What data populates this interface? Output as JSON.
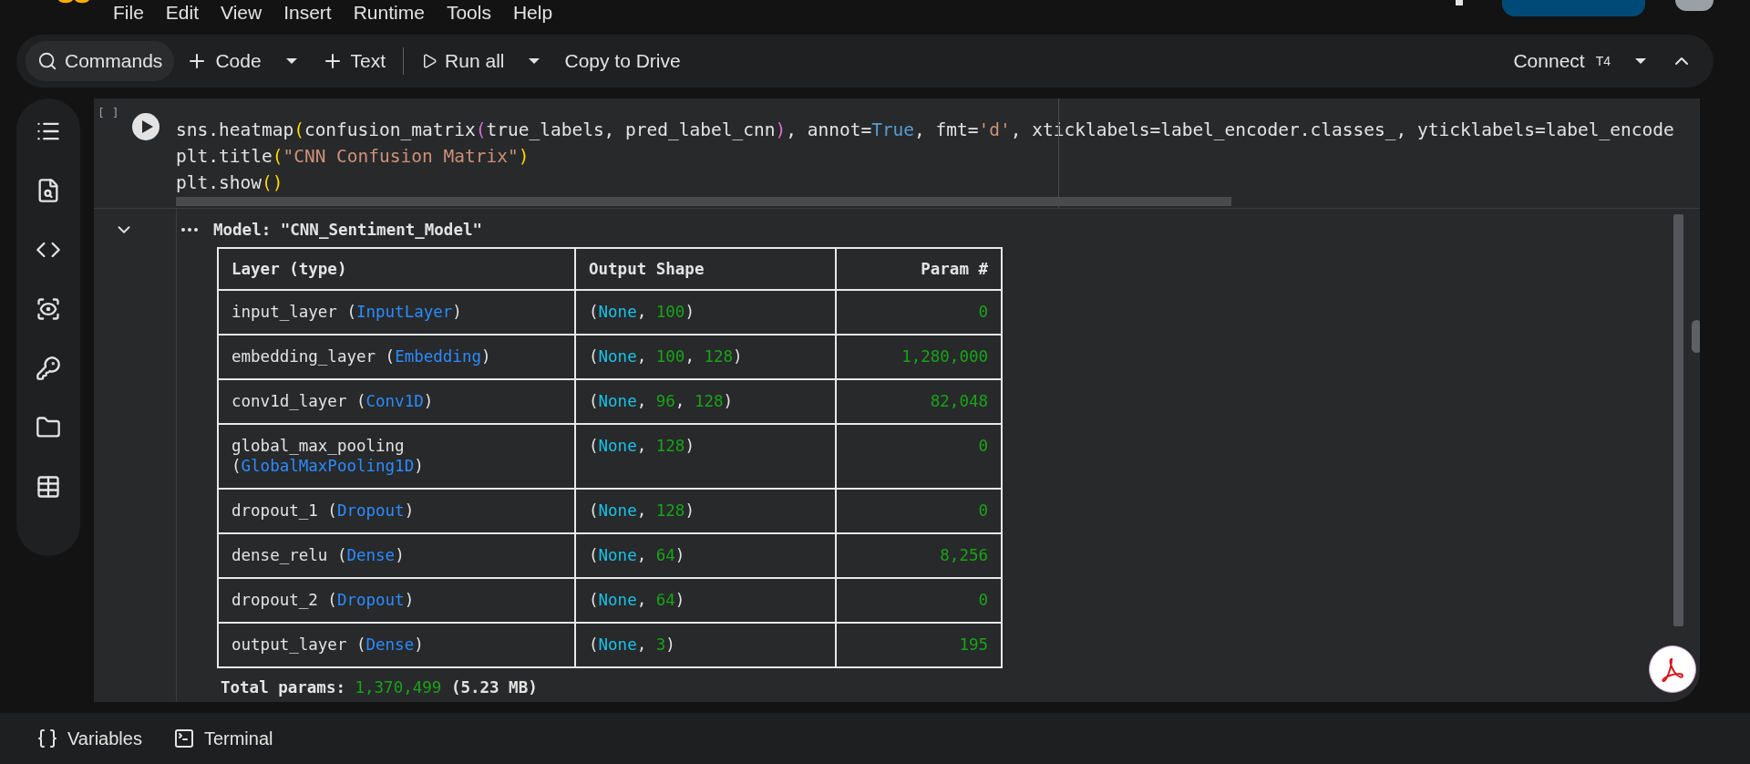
{
  "menu": [
    "File",
    "Edit",
    "View",
    "Insert",
    "Runtime",
    "Tools",
    "Help"
  ],
  "toolbar": [
    {
      "kind": "search",
      "label": "Commands"
    },
    {
      "kind": "add",
      "label": "Code"
    },
    {
      "kind": "caret"
    },
    {
      "kind": "add",
      "label": "Text"
    },
    {
      "kind": "separator"
    },
    {
      "kind": "run",
      "label": "Run all"
    },
    {
      "kind": "caret"
    },
    {
      "kind": "plain",
      "label": "Copy to Drive"
    }
  ],
  "connect": {
    "label": "Connect",
    "runtime": "T4"
  },
  "sidebar": [
    {
      "kind": "toc"
    },
    {
      "kind": "find"
    },
    {
      "kind": "code"
    },
    {
      "kind": "eye"
    },
    {
      "kind": "key"
    },
    {
      "kind": "folder"
    },
    {
      "kind": "table"
    }
  ],
  "cell": {
    "exec_count": "[ ]",
    "code": [
      [
        {
          "kind": "plain",
          "text": "sns.heatmap"
        },
        {
          "kind": "bracket",
          "text": "("
        },
        {
          "kind": "plain",
          "text": "confusion_matrix"
        },
        {
          "kind": "bracket2",
          "text": "("
        },
        {
          "kind": "plain",
          "text": "true_labels, pred_label_cnn"
        },
        {
          "kind": "bracket2",
          "text": ")"
        },
        {
          "kind": "plain",
          "text": ", annot="
        },
        {
          "kind": "keyword",
          "text": "True"
        },
        {
          "kind": "plain",
          "text": ", fmt="
        },
        {
          "kind": "string",
          "text": "'d'"
        },
        {
          "kind": "plain",
          "text": ", xticklabels=label_encoder.classes_, yticklabels=label_encode"
        }
      ],
      [
        {
          "kind": "plain",
          "text": "plt.title"
        },
        {
          "kind": "bracket",
          "text": "("
        },
        {
          "kind": "string",
          "text": "\"CNN Confusion Matrix\""
        },
        {
          "kind": "bracket",
          "text": ")"
        }
      ],
      [
        {
          "kind": "plain",
          "text": "plt.show"
        },
        {
          "kind": "bracket",
          "text": "()"
        }
      ]
    ],
    "output": {
      "title": "Model: \"CNN_Sentiment_Model\"",
      "columns": [
        "Layer (type)",
        "Output Shape",
        "Param #"
      ],
      "rows": [
        [
          [
            {
              "kind": "plain",
              "text": "input_layer ("
            },
            {
              "kind": "type",
              "text": "InputLayer"
            },
            {
              "kind": "plain",
              "text": ")"
            }
          ],
          [
            {
              "kind": "plain",
              "text": "("
            },
            {
              "kind": "none",
              "text": "None"
            },
            {
              "kind": "plain",
              "text": ", "
            },
            {
              "kind": "num",
              "text": "100"
            },
            {
              "kind": "plain",
              "text": ")"
            }
          ],
          [
            {
              "kind": "num",
              "text": "0"
            }
          ]
        ],
        [
          [
            {
              "kind": "plain",
              "text": "embedding_layer ("
            },
            {
              "kind": "type",
              "text": "Embedding"
            },
            {
              "kind": "plain",
              "text": ")"
            }
          ],
          [
            {
              "kind": "plain",
              "text": "("
            },
            {
              "kind": "none",
              "text": "None"
            },
            {
              "kind": "plain",
              "text": ", "
            },
            {
              "kind": "num",
              "text": "100"
            },
            {
              "kind": "plain",
              "text": ", "
            },
            {
              "kind": "num",
              "text": "128"
            },
            {
              "kind": "plain",
              "text": ")"
            }
          ],
          [
            {
              "kind": "num",
              "text": "1,280,000"
            }
          ]
        ],
        [
          [
            {
              "kind": "plain",
              "text": "conv1d_layer ("
            },
            {
              "kind": "type",
              "text": "Conv1D"
            },
            {
              "kind": "plain",
              "text": ")"
            }
          ],
          [
            {
              "kind": "plain",
              "text": "("
            },
            {
              "kind": "none",
              "text": "None"
            },
            {
              "kind": "plain",
              "text": ", "
            },
            {
              "kind": "num",
              "text": "96"
            },
            {
              "kind": "plain",
              "text": ", "
            },
            {
              "kind": "num",
              "text": "128"
            },
            {
              "kind": "plain",
              "text": ")"
            }
          ],
          [
            {
              "kind": "num",
              "text": "82,048"
            }
          ]
        ],
        [
          [
            {
              "kind": "plain",
              "text": "global_max_pooling\n("
            },
            {
              "kind": "type",
              "text": "GlobalMaxPooling1D"
            },
            {
              "kind": "plain",
              "text": ")"
            }
          ],
          [
            {
              "kind": "plain",
              "text": "("
            },
            {
              "kind": "none",
              "text": "None"
            },
            {
              "kind": "plain",
              "text": ", "
            },
            {
              "kind": "num",
              "text": "128"
            },
            {
              "kind": "plain",
              "text": ")"
            }
          ],
          [
            {
              "kind": "num",
              "text": "0"
            }
          ]
        ],
        [
          [
            {
              "kind": "plain",
              "text": "dropout_1 ("
            },
            {
              "kind": "type",
              "text": "Dropout"
            },
            {
              "kind": "plain",
              "text": ")"
            }
          ],
          [
            {
              "kind": "plain",
              "text": "("
            },
            {
              "kind": "none",
              "text": "None"
            },
            {
              "kind": "plain",
              "text": ", "
            },
            {
              "kind": "num",
              "text": "128"
            },
            {
              "kind": "plain",
              "text": ")"
            }
          ],
          [
            {
              "kind": "num",
              "text": "0"
            }
          ]
        ],
        [
          [
            {
              "kind": "plain",
              "text": "dense_relu ("
            },
            {
              "kind": "type",
              "text": "Dense"
            },
            {
              "kind": "plain",
              "text": ")"
            }
          ],
          [
            {
              "kind": "plain",
              "text": "("
            },
            {
              "kind": "none",
              "text": "None"
            },
            {
              "kind": "plain",
              "text": ", "
            },
            {
              "kind": "num",
              "text": "64"
            },
            {
              "kind": "plain",
              "text": ")"
            }
          ],
          [
            {
              "kind": "num",
              "text": "8,256"
            }
          ]
        ],
        [
          [
            {
              "kind": "plain",
              "text": "dropout_2 ("
            },
            {
              "kind": "type",
              "text": "Dropout"
            },
            {
              "kind": "plain",
              "text": ")"
            }
          ],
          [
            {
              "kind": "plain",
              "text": "("
            },
            {
              "kind": "none",
              "text": "None"
            },
            {
              "kind": "plain",
              "text": ", "
            },
            {
              "kind": "num",
              "text": "64"
            },
            {
              "kind": "plain",
              "text": ")"
            }
          ],
          [
            {
              "kind": "num",
              "text": "0"
            }
          ]
        ],
        [
          [
            {
              "kind": "plain",
              "text": "output_layer ("
            },
            {
              "kind": "type",
              "text": "Dense"
            },
            {
              "kind": "plain",
              "text": ")"
            }
          ],
          [
            {
              "kind": "plain",
              "text": "("
            },
            {
              "kind": "none",
              "text": "None"
            },
            {
              "kind": "plain",
              "text": ", "
            },
            {
              "kind": "num",
              "text": "3"
            },
            {
              "kind": "plain",
              "text": ")"
            }
          ],
          [
            {
              "kind": "num",
              "text": "195"
            }
          ]
        ]
      ],
      "total": [
        {
          "kind": "bold",
          "text": "Total params: "
        },
        {
          "kind": "num",
          "text": "1,370,499"
        },
        {
          "kind": "bold",
          "text": " (5.23 MB)"
        }
      ]
    }
  },
  "bottom": [
    {
      "kind": "variables",
      "label": "Variables"
    },
    {
      "kind": "terminal",
      "label": "Terminal"
    }
  ]
}
